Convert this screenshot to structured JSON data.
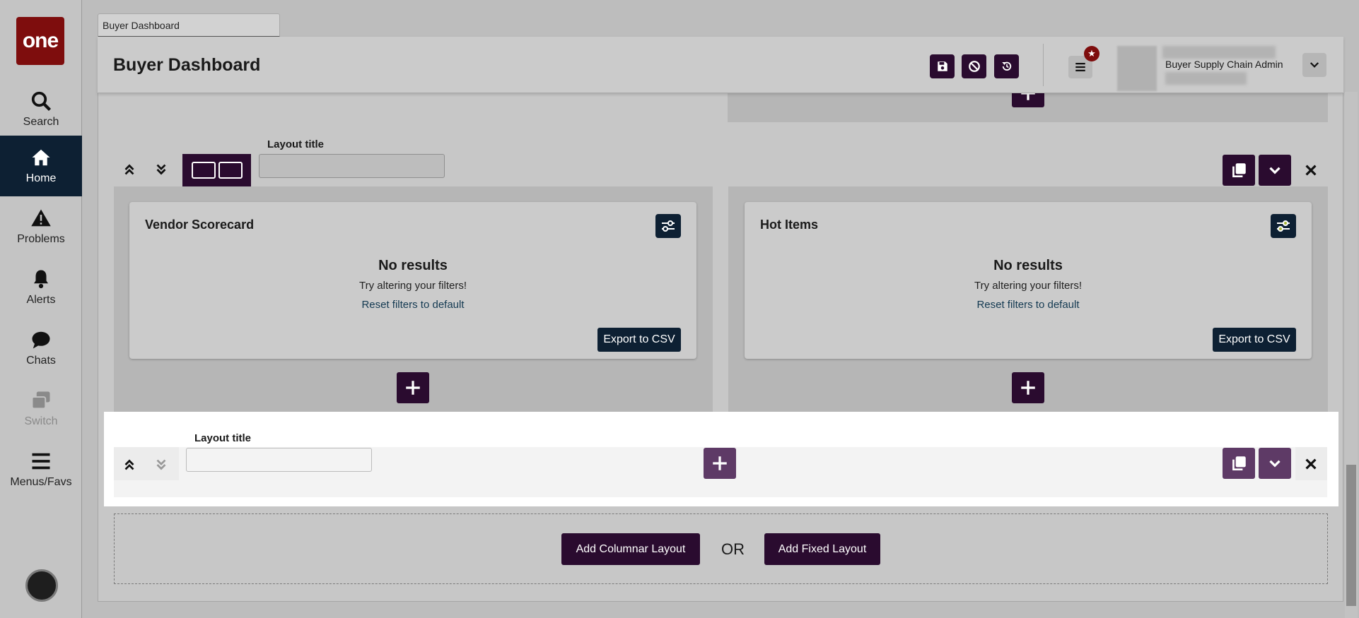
{
  "sidebar": {
    "logo": "one",
    "items": [
      {
        "label": "Search",
        "icon": "search-icon"
      },
      {
        "label": "Home",
        "icon": "home-icon"
      },
      {
        "label": "Problems",
        "icon": "warning-icon"
      },
      {
        "label": "Alerts",
        "icon": "bell-icon"
      },
      {
        "label": "Chats",
        "icon": "chat-icon"
      },
      {
        "label": "Switch",
        "icon": "switch-icon"
      },
      {
        "label": "Menus/Favs",
        "icon": "menu-icon"
      }
    ]
  },
  "tab": {
    "label": "Buyer Dashboard"
  },
  "header": {
    "title": "Buyer Dashboard",
    "user_name": "Buyer Supply Chain Admin"
  },
  "layout1": {
    "title_label": "Layout title",
    "title_value": ""
  },
  "layout2": {
    "title_label": "Layout title",
    "title_value": ""
  },
  "cards": [
    {
      "title": "Vendor Scorecard",
      "no_results": "No results",
      "hint": "Try altering your filters!",
      "reset": "Reset filters to default",
      "export": "Export to CSV"
    },
    {
      "title": "Hot Items",
      "no_results": "No results",
      "hint": "Try altering your filters!",
      "reset": "Reset filters to default",
      "export": "Export to CSV"
    }
  ],
  "footer": {
    "add_columnar": "Add Columnar Layout",
    "or": "OR",
    "add_fixed": "Add Fixed Layout"
  },
  "colors": {
    "brand": "#7e0d0d",
    "primary": "#2a0b2f",
    "navy": "#0d2033",
    "link": "#143a52"
  }
}
